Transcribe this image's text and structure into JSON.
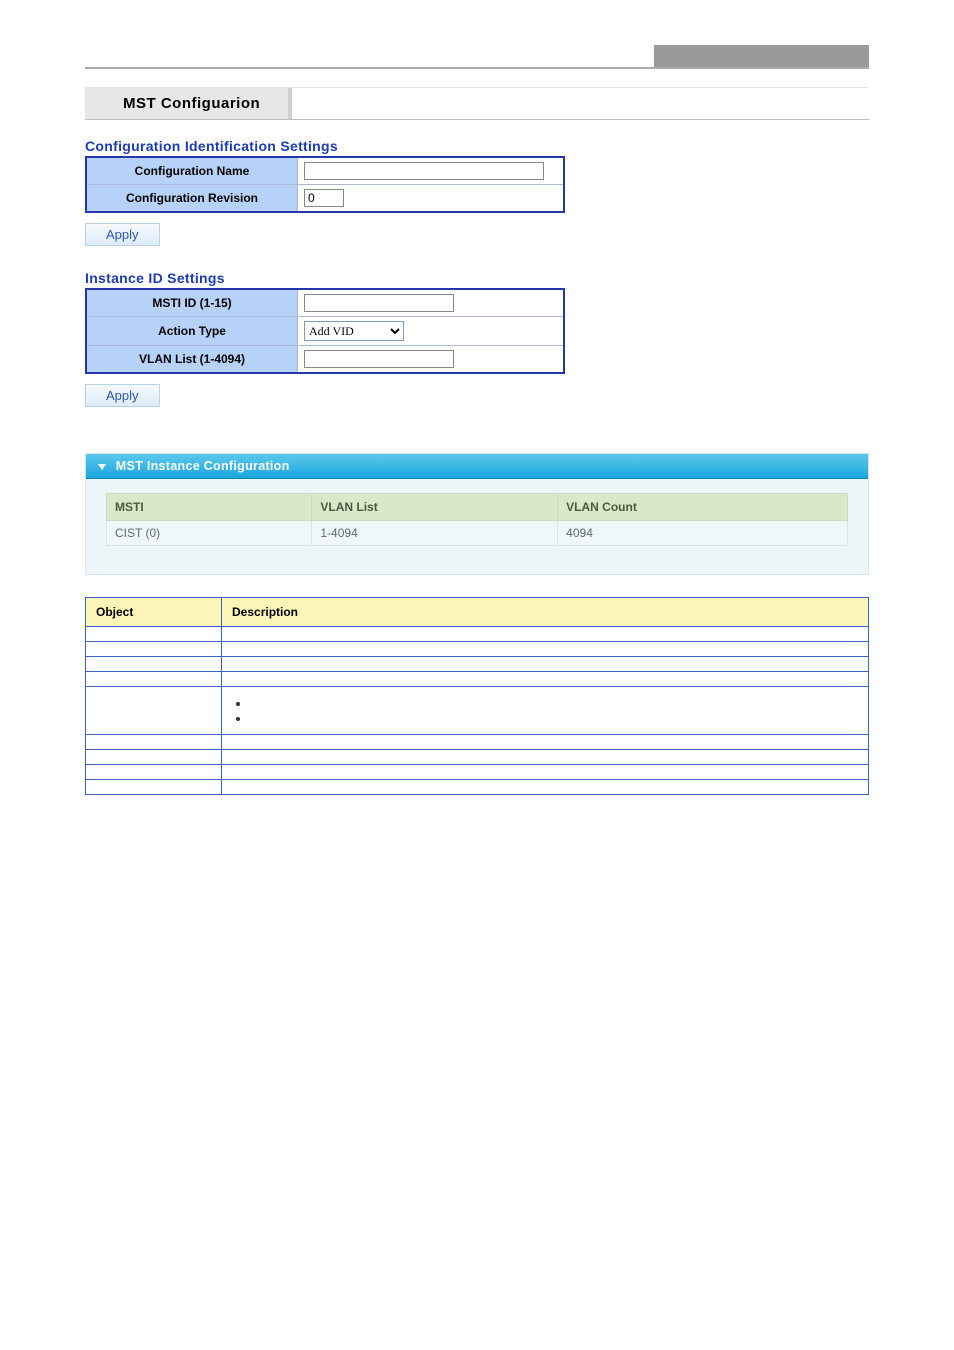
{
  "header_brand": "",
  "page_title": "MST Configuarion",
  "section_config_id": {
    "title": "Configuration Identification Settings",
    "rows": {
      "name_label": "Configuration Name",
      "name_value": "",
      "rev_label": "Configuration Revision",
      "rev_value": "0"
    }
  },
  "section_instance": {
    "title": "Instance ID Settings",
    "rows": {
      "msti_label": "MSTI ID (1-15)",
      "msti_value": "",
      "action_label": "Action Type",
      "action_value": "Add VID",
      "action_options": [
        "Add VID"
      ],
      "vlan_label": "VLAN List (1-4094)",
      "vlan_value": ""
    }
  },
  "apply_label": "Apply",
  "panel": {
    "title": "MST Instance Configuration",
    "columns": [
      "MSTI",
      "VLAN List",
      "VLAN Count"
    ],
    "rows": [
      {
        "msti": "CIST (0)",
        "vlan_list": "1-4094",
        "vlan_count": "4094"
      }
    ]
  },
  "fig_caption": "",
  "desc_intro": "",
  "desc_table": {
    "headers": [
      "Object",
      "Description"
    ],
    "rows": [
      {
        "obj": "",
        "desc": ""
      },
      {
        "obj": "",
        "desc": ""
      },
      {
        "obj": "",
        "desc": ""
      },
      {
        "obj": "",
        "desc": ""
      },
      {
        "obj": "",
        "desc_pre": "",
        "bullets": [
          "",
          ""
        ]
      },
      {
        "obj": "",
        "desc": ""
      },
      {
        "obj": "",
        "desc": ""
      },
      {
        "obj": "",
        "desc": ""
      },
      {
        "obj": "",
        "desc": ""
      }
    ]
  },
  "page_number": ""
}
